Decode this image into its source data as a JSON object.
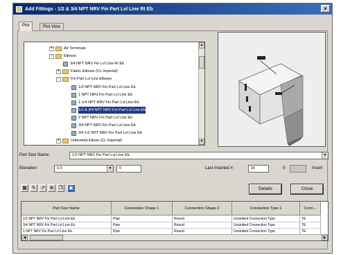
{
  "window": {
    "title": "Add Fittings - 1/2 & 3/4 NPT NRV Fin Part Lvl Line Rt Eb"
  },
  "tabs": [
    {
      "label": "Plot"
    },
    {
      "label": "Plot View"
    }
  ],
  "tree": {
    "items": [
      {
        "label": "Air Terminals",
        "kind": "folder",
        "expander": "+"
      },
      {
        "label": "Elbows",
        "kind": "folder",
        "expander": "-"
      },
      {
        "label": "3/4 NPT NRV Fin Lvl Line Rt Eb",
        "kind": "part",
        "expander": ""
      },
      {
        "label": "Fabric Elbows (CL Imperial)",
        "kind": "folder",
        "expander": "+"
      },
      {
        "label": "Fin Part Lvl Line Elbows",
        "kind": "folder",
        "expander": "-"
      },
      {
        "label": "1/2 NPT NRV Fin Part Lvl Line Eb",
        "kind": "part",
        "expander": ""
      },
      {
        "label": "1 NPT NRV Fin Part Lvl Line Eb",
        "kind": "part",
        "expander": ""
      },
      {
        "label": "1-1/4 NPT NRV Fin Part Lvl Line Eb",
        "kind": "part",
        "expander": ""
      },
      {
        "label": "1/2 & 3/4 NPT NRV Fin Part Lvl Line Eb",
        "kind": "part",
        "expander": "",
        "selected": true
      },
      {
        "label": "2 NPT NRV Fin Part Lvl Line Eb",
        "kind": "part",
        "expander": ""
      },
      {
        "label": "3/4 NPT NRV Fin Part Lvl Line Eb",
        "kind": "part",
        "expander": ""
      },
      {
        "label": "3/4 1/2 NPT NRV Fin Part Lvl Line Eb",
        "kind": "part",
        "expander": ""
      },
      {
        "label": "Unleveled Elbow (CL Imperial)",
        "kind": "folder",
        "expander": "+"
      }
    ]
  },
  "form": {
    "part_size_label": "Part Size Name:",
    "part_size_value": "1/2 NPT NRV Fin Part Lvl Line Eb",
    "elevation_label": "Elevation:",
    "elevation_value": "0.0",
    "elevation_second": "0",
    "last_inserted_label": "Last Inserted #:",
    "last_inserted_value": "00",
    "count_value": "0",
    "insert_label": "Insert"
  },
  "toolbar": {
    "icons": [
      "grid-icon",
      "pencil-icon",
      "draw-icon",
      "offset-icon",
      "copy-icon",
      "save-icon"
    ]
  },
  "buttons": {
    "details": "Details",
    "close": "Close"
  },
  "table": {
    "headers": [
      "Part Size Name",
      "Connection Shape 1",
      "Connection Shape 2",
      "Connection Type 1",
      "Conn..."
    ],
    "rows": [
      [
        "1/2 NPT NRV Fin Part Lvl Line Eb",
        "Pipe",
        "Round",
        "Unslotted Connection Type",
        "TE"
      ],
      [
        "3/4 NPT NRV Fin Part Lvl Line Eb",
        "Pipe",
        "Round",
        "Unslotted Connection Type",
        "TE"
      ],
      [
        "1 NPT NRV Fin Part Lvl Line Eb",
        "Pipe",
        "Round",
        "Unslotted Connection Type",
        "TE"
      ]
    ]
  },
  "colors": {
    "title_bar": "#0a2a6b",
    "selection": "#1a3a8c",
    "panel": "#d9d6cf"
  }
}
